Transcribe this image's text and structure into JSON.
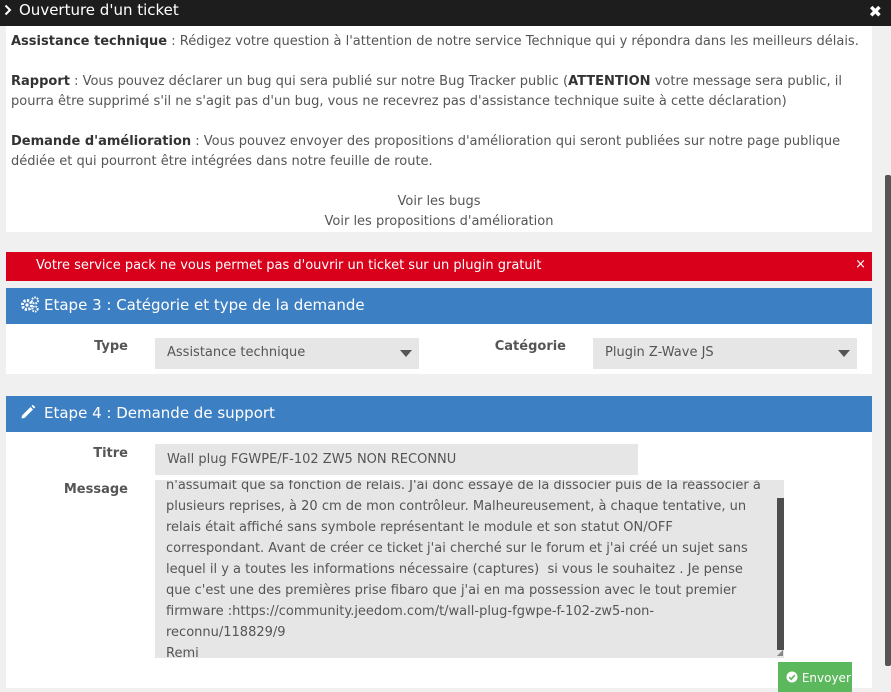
{
  "modal": {
    "title": "Ouverture d'un ticket"
  },
  "info": {
    "assistance_label": "Assistance technique",
    "assistance_text": " : Rédigez votre question à l'attention de notre service Technique qui y répondra dans les meilleurs délais.",
    "rapport_label": "Rapport",
    "rapport_text_1": " : Vous pouvez déclarer un bug qui sera publié sur notre Bug Tracker public (",
    "rapport_attention": "ATTENTION",
    "rapport_text_2": " votre message sera public, il pourra être supprimé s'il ne s'agit pas d'un bug, vous ne recevrez pas d'assistance technique suite à cette déclaration)",
    "amelioration_label": "Demande d'amélioration",
    "amelioration_text": " : Vous pouvez envoyer des propositions d'amélioration qui seront publiées sur notre page publique dédiée et qui pourront être intégrées dans notre feuille de route.",
    "link_bugs": "Voir les bugs",
    "link_ameliorations": "Voir les propositions d'amélioration"
  },
  "alert": {
    "message": "Votre service pack ne vous permet pas d'ouvrir un ticket sur un plugin gratuit",
    "close": "×"
  },
  "step3": {
    "title": "Etape 3 : Catégorie et type de la demande",
    "type_label": "Type",
    "type_value": "Assistance technique",
    "category_label": "Catégorie",
    "category_value": "Plugin Z-Wave JS"
  },
  "step4": {
    "title": "Etape 4 : Demande de support",
    "title_label": "Titre",
    "title_value": "Wall plug FGWPE/F-102 ZW5 NON RECONNU",
    "message_label": "Message",
    "message_value": "n'assumait que sa fonction de relais. J'ai donc essayé de la dissocier puis de la réassocier à plusieurs reprises, à 20 cm de mon contrôleur. Malheureusement, à chaque tentative, un relais était affiché sans symbole représentant le module et son statut ON/OFF correspondant. Avant de créer ce ticket j'ai cherché sur le forum et j'ai créé un sujet sans lequel il y a toutes les informations nécessaire (captures)  si vous le souhaitez . Je pense que c'est une des premières prise fibaro que j'ai en ma possession avec le tout premier firmware :https://community.jeedom.com/t/wall-plug-fgwpe-f-102-zw5-non-reconnu/118829/9\nRemi"
  },
  "send_button": "Envoyer",
  "icons": {
    "chevron": "chevron-right-icon",
    "close": "close-icon",
    "gears": "gears-icon",
    "pencil": "pencil-icon",
    "check": "check-circle-icon"
  },
  "colors": {
    "titlebar": "#1d1d1d",
    "alert": "#d9001b",
    "panel_header": "#3d7fc3",
    "send_button": "#5cb85c"
  }
}
